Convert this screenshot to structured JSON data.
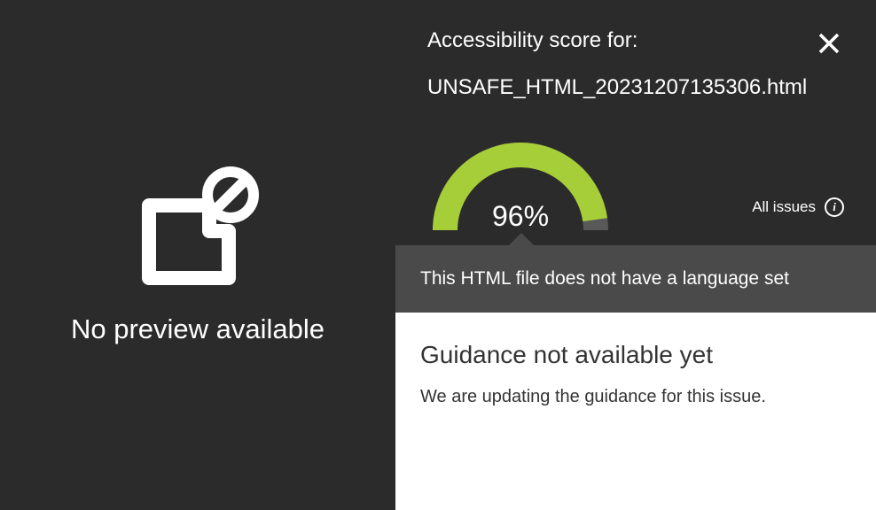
{
  "preview": {
    "message": "No preview available"
  },
  "header": {
    "score_label": "Accessibility score for:",
    "filename": "UNSAFE_HTML_20231207135306.html"
  },
  "gauge": {
    "percent_label": "96%",
    "percent_value": 96
  },
  "all_issues": {
    "label": "All issues"
  },
  "issue": {
    "message": "This HTML file does not have a language set"
  },
  "guidance": {
    "title": "Guidance not available yet",
    "body": "We are updating the guidance for this issue."
  }
}
